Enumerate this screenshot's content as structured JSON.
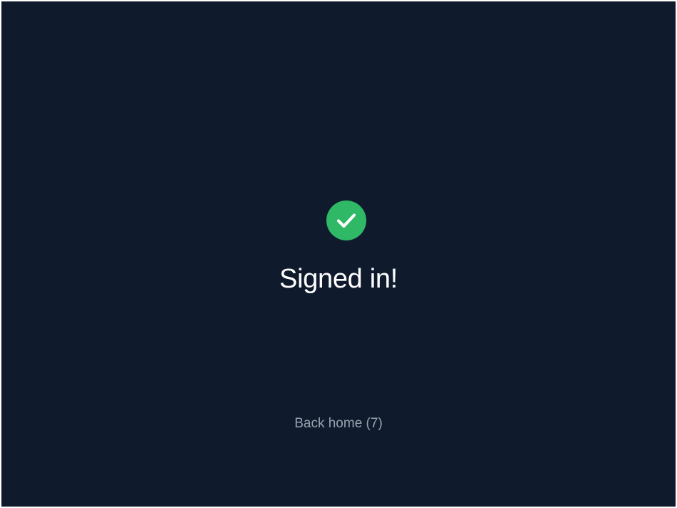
{
  "status": {
    "icon": "check-circle-icon",
    "icon_color": "#2fb865",
    "title": "Signed in!"
  },
  "actions": {
    "back_home_label": "Back home (7)"
  },
  "theme": {
    "background": "#0f1b2d",
    "title_color": "#ffffff",
    "link_color": "#9aa3b0"
  }
}
